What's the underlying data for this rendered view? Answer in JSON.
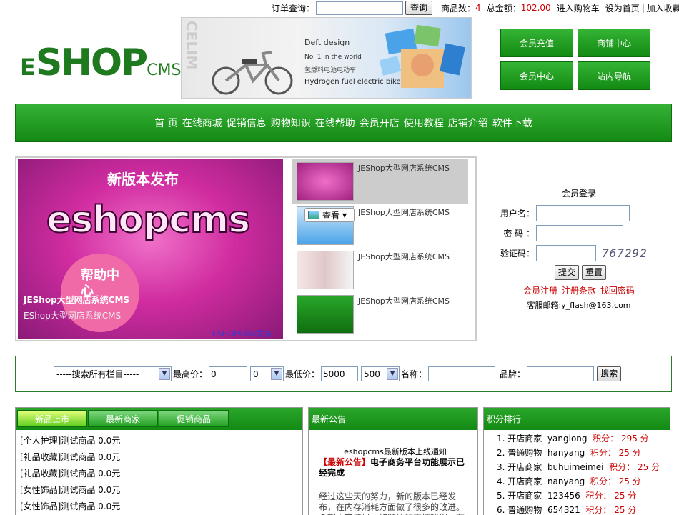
{
  "topbar": {
    "order_query_label": "订单查询：",
    "query_button": "查询",
    "count_label": "商品数：",
    "count_value": "4",
    "total_label": "总金额：",
    "total_value": "102.00",
    "cart_link": "进入购物车",
    "home_link": "设为首页",
    "sep": "|",
    "fav_link": "加入收藏"
  },
  "logo": {
    "e": "E",
    "shop": "SHOP",
    "cms": "CMS"
  },
  "banner": {
    "vertical": "CELIM",
    "line1": "Deft design",
    "line2": "No. 1 in the world",
    "line3": "氢燃料电池电动车",
    "line4": "Hydrogen fuel electric bike"
  },
  "member_buttons": [
    "会员充值",
    "商铺中心",
    "会员中心",
    "站内导航"
  ],
  "nav": [
    "首 页",
    "在线商城",
    "促销信息",
    "购物知识",
    "在线帮助",
    "会员开店",
    "使用教程",
    "店铺介绍",
    "软件下载"
  ],
  "slide": {
    "heading": "新版本发布",
    "brand": "eshopcms",
    "help": "帮助中心",
    "caption_bold": "JEShop大型网店系统CMS",
    "caption": "EShop大型网店系统CMS",
    "caption_link": "ESHOPCMS发布"
  },
  "thumbs": [
    {
      "label": "JEShop大型网店系统CMS"
    },
    {
      "label": "JEShop大型网店系统CMS"
    },
    {
      "label": "JEShop大型网店系统CMS"
    },
    {
      "label": "JEShop大型网店系统CMS"
    }
  ],
  "view_popup": "查看",
  "login": {
    "title": "会员登录",
    "username_label": "用户名：",
    "password_label": "密 码 ：",
    "captcha_label": "验证码：",
    "captcha_code": "767292",
    "submit": "提交",
    "reset": "重置",
    "register": "会员注册",
    "terms": "注册条款",
    "forgot": "找回密码",
    "mail": "客服邮箱:y_flash@163.com"
  },
  "search": {
    "category": "-----搜索所有栏目-----",
    "max_label": "最高价：",
    "max_value": "0",
    "max_select": "0",
    "min_label": "最低价：",
    "min_value": "5000",
    "min_select": "500",
    "name_label": "名称：",
    "brand_label": "品牌：",
    "button": "搜索"
  },
  "products": {
    "tabs": [
      "新品上市",
      "最新商家",
      "促销商品"
    ],
    "items": [
      "[个人护理]测试商品  0.0元",
      "[礼品收藏]测试商品  0.0元",
      "[礼品收藏]测试商品  0.0元",
      "[女性饰品]测试商品  0.0元",
      "[女性饰品]测试商品  0.0元"
    ]
  },
  "news": {
    "header": "最新公告",
    "title": "eshopcms最新版本上线通知",
    "bracket": "【最新公告】",
    "headline": "电子商务平台功能展示已经完成",
    "body": "经过这些天的努力，新的版本已经发布，在内存消耗方面做了很多的改进。希望大家还是一如既往的支持我们，在此，谢谢"
  },
  "rank": {
    "header": "积分排行",
    "rows": [
      {
        "n": "1.",
        "type": "开店商家",
        "name": "yanglong",
        "label": "积分：",
        "pts": "295 分"
      },
      {
        "n": "2.",
        "type": "普通购物",
        "name": "hanyang",
        "label": "积分：",
        "pts": "25 分"
      },
      {
        "n": "3.",
        "type": "开店商家",
        "name": "buhuimeimei",
        "label": "积分：",
        "pts": "25 分"
      },
      {
        "n": "4.",
        "type": "开店商家",
        "name": "nanyang",
        "label": "积分：",
        "pts": "25 分"
      },
      {
        "n": "5.",
        "type": "开店商家",
        "name": "123456",
        "label": "积分：",
        "pts": "25 分"
      },
      {
        "n": "6.",
        "type": "普通购物",
        "name": "654321",
        "label": "积分：",
        "pts": "25 分"
      }
    ]
  }
}
